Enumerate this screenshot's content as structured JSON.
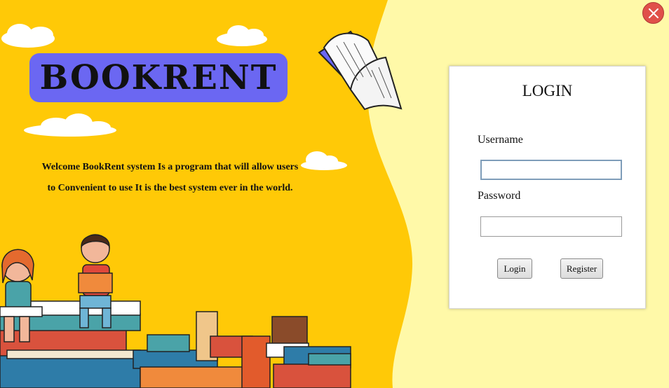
{
  "brand": {
    "logo_text": "BOOKRENT",
    "welcome_line1": "Welcome BookRent system Is a program that will allow users",
    "welcome_line2": "to Convenient to use It is the best system ever in the world."
  },
  "login": {
    "title": "LOGIN",
    "username_label": "Username",
    "username_value": "",
    "password_label": "Password",
    "password_value": "",
    "login_button": "Login",
    "register_button": "Register"
  },
  "colors": {
    "left_panel": "#ffc907",
    "right_panel": "#fff9a8",
    "logo_box": "#6b67f2",
    "close_button": "#e0504a"
  },
  "icons": {
    "close": "close-icon",
    "book": "open-book-illustration"
  }
}
